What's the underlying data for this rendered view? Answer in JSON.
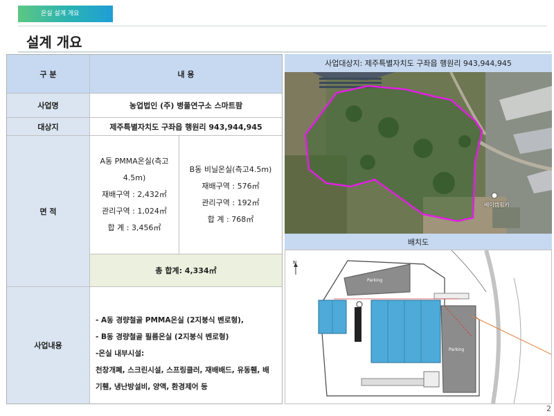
{
  "header": {
    "tag": "온실 설계 개요",
    "title": "설계 개요"
  },
  "table": {
    "col_header_1": "구 분",
    "col_header_2": "내 용",
    "project_label": "사업명",
    "project_value": "농업법인 (주) 병풀연구소  스마트팜",
    "site_label": "대상지",
    "site_value": "제주특별자치도 구좌읍 행원리 943,944,945",
    "area_label": "면 적",
    "area_a": {
      "title": "A동 PMMA온실(측고4.5m)",
      "line1": "재배구역 : 2,432㎡",
      "line2": "관리구역 : 1,024㎡",
      "line3": "합 계 : 3,456㎡"
    },
    "area_b": {
      "title": "B동 비닐온실(측고4.5m)",
      "line1": "재배구역 : 576㎡",
      "line2": "관리구역 : 192㎡",
      "line3": "합 계 : 768㎡"
    },
    "total": "총 합계: 4,334㎡",
    "business_label": "사업내용",
    "business_lines": [
      "- A동 경량철골 PMMA온실 (2지붕식 벤로형),",
      "- B동 경량철골 필름온실 (2지붕식 벤로형)",
      "-온실 내부시설:",
      "천창개폐, 스크린시설, 스프링클러, 재배배드, 유동휀, 배",
      "기휀, 냉난방설비, 양액, 환경제어 등"
    ]
  },
  "map": {
    "heading": "사업대상지: 제주특별자치도 구좌읍 행원리 943,944,945",
    "place_label": "베이캠핑카"
  },
  "plan": {
    "heading": "배치도",
    "north": "N",
    "parking_top": "Parking",
    "parking_right": "Parking"
  },
  "page_number": "2",
  "colors": {
    "header_blue": "#c6d9f1",
    "label_blue": "#dbe5f1",
    "sum_green": "#ebf1de",
    "boundary_magenta": "#e020e0",
    "greenhouse_blue": "#4eaad8"
  }
}
